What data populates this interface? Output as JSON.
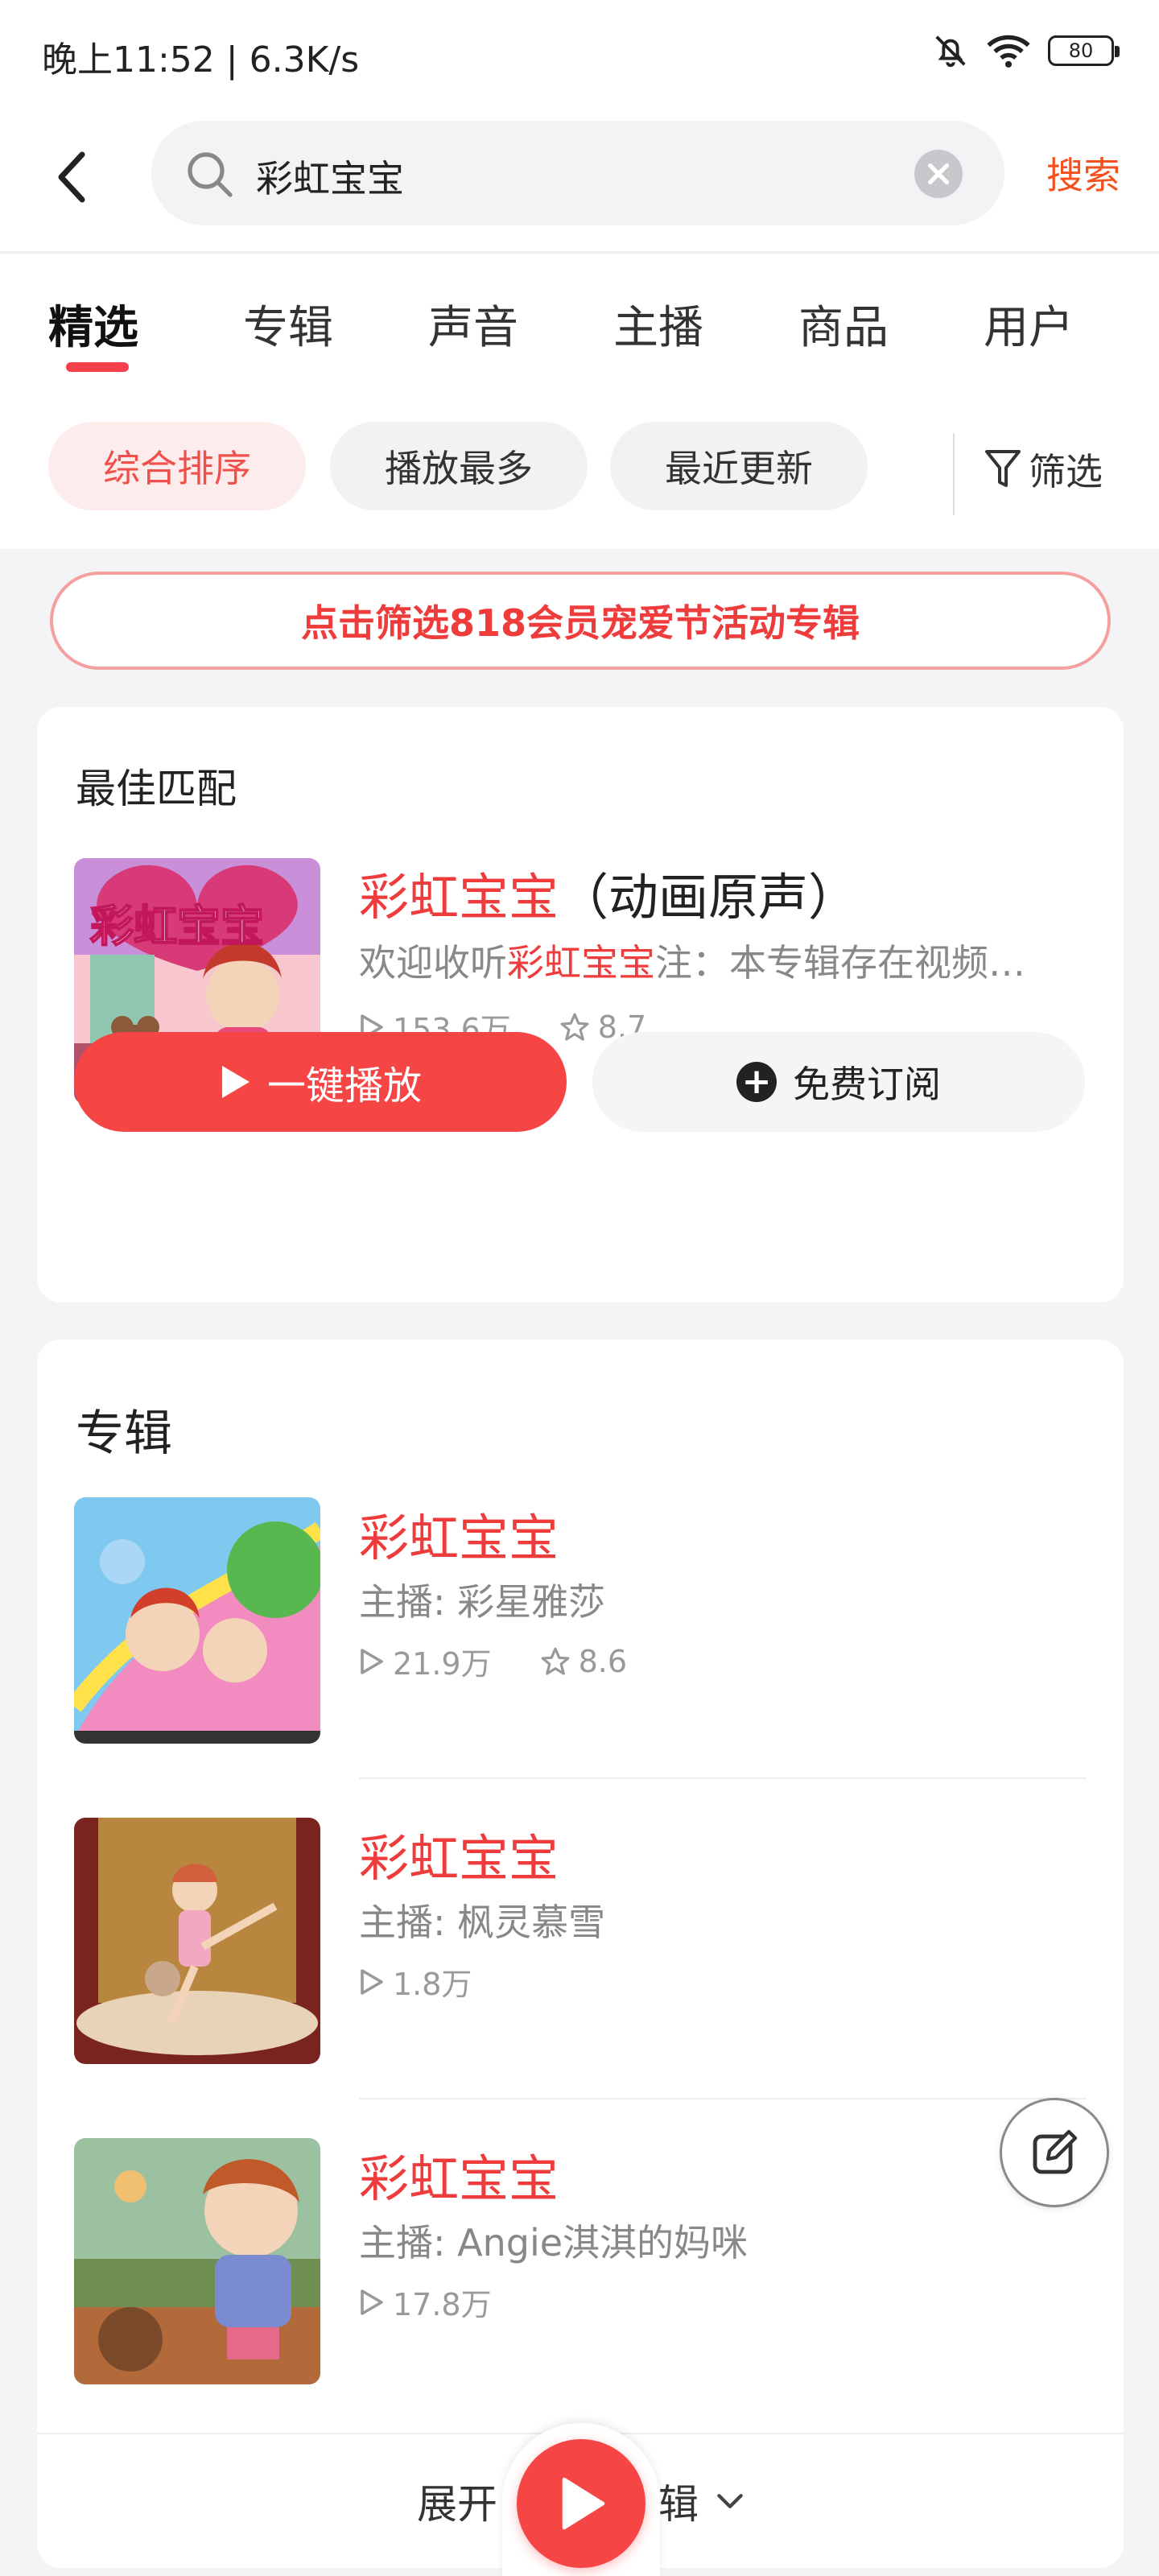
{
  "status_bar": {
    "time": "晚上11:52 | 6.3K/s",
    "battery": "80"
  },
  "header": {
    "search_value": "彩虹宝宝",
    "search_button": "搜索"
  },
  "tabs": [
    {
      "label": "精选",
      "active": true
    },
    {
      "label": "专辑",
      "active": false
    },
    {
      "label": "声音",
      "active": false
    },
    {
      "label": "主播",
      "active": false
    },
    {
      "label": "商品",
      "active": false
    },
    {
      "label": "用户",
      "active": false
    }
  ],
  "sort_chips": [
    {
      "label": "综合排序",
      "active": true
    },
    {
      "label": "播放最多",
      "active": false
    },
    {
      "label": "最近更新",
      "active": false
    }
  ],
  "filter_label": "筛选",
  "banner": "点击筛选818会员宠爱节活动专辑",
  "best_match": {
    "section_title": "最佳匹配",
    "title_highlight": "彩虹宝宝",
    "title_rest": "（动画原声）",
    "desc_prefix": "欢迎收听",
    "desc_highlight": "彩虹宝宝",
    "desc_rest": "注：本专辑存在视频…",
    "plays": "153.6万",
    "rating": "8.7",
    "cover_text": "彩虹宝宝",
    "play_button": "一键播放",
    "subscribe_button": "免费订阅"
  },
  "albums": {
    "section_title": "专辑",
    "items": [
      {
        "title": "彩虹宝宝",
        "host": "主播: 彩星雅莎",
        "plays": "21.9万",
        "rating": "8.6"
      },
      {
        "title": "彩虹宝宝",
        "host": "主播: 枫灵慕雪",
        "plays": "1.8万",
        "rating": ""
      },
      {
        "title": "彩虹宝宝",
        "host": "主播: Angie淇淇的妈咪",
        "plays": "17.8万",
        "rating": ""
      }
    ],
    "expand_left": "展开",
    "expand_right": "辑"
  },
  "colors": {
    "accent": "#f64545",
    "accent_text": "#ee3c3c",
    "search_btn": "#f4511e"
  }
}
